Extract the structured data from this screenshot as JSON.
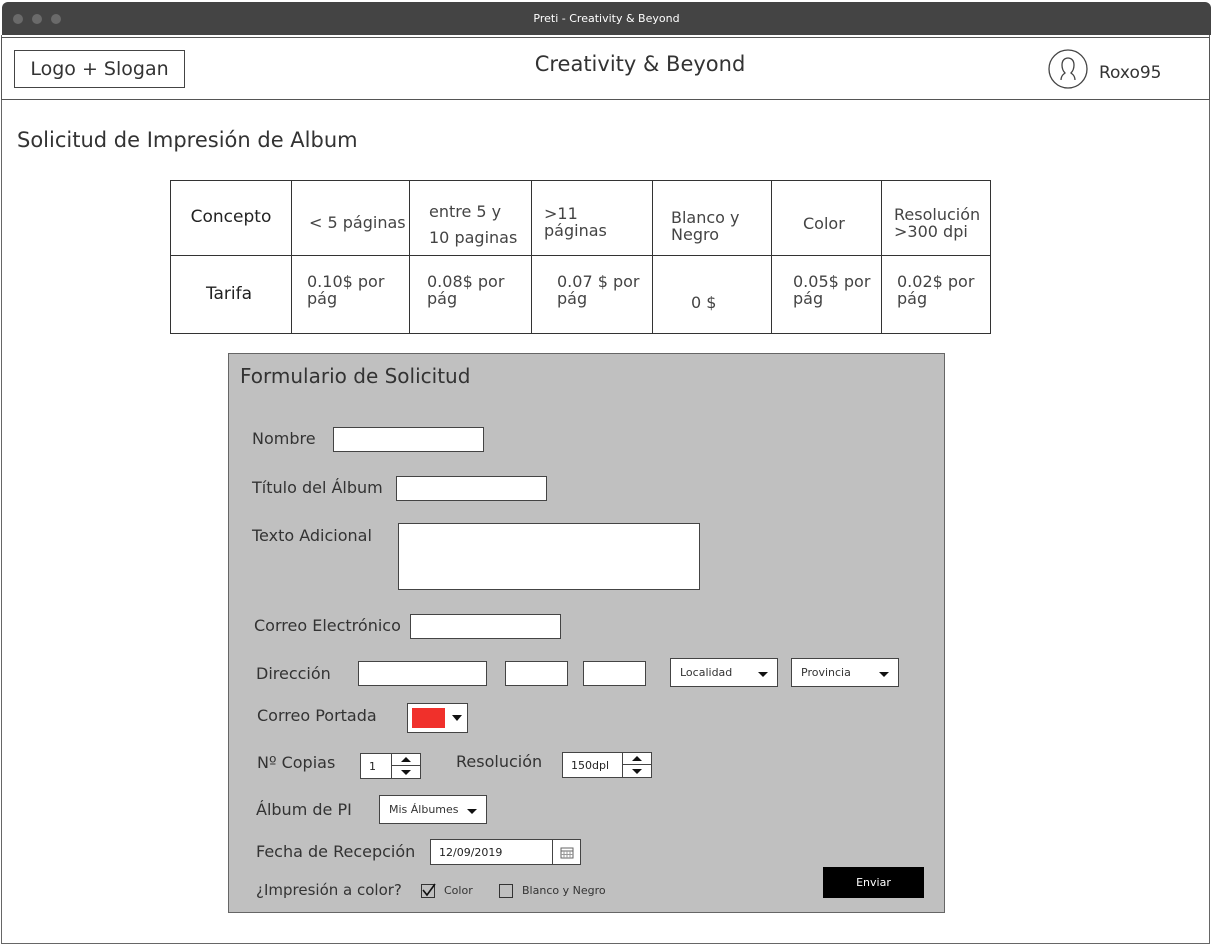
{
  "window": {
    "title": "Preti - Creativity & Beyond"
  },
  "header": {
    "logo_label": "Logo + Slogan",
    "site_title": "Creativity & Beyond",
    "username": "Roxo95"
  },
  "page": {
    "heading": "Solicitud de Impresión de Album"
  },
  "rate_table": {
    "columns": [
      "Concepto",
      "< 5 páginas",
      "entre 5 y 10 paginas",
      ">11 páginas",
      "Blanco y Negro",
      "Color",
      "Resolución >300 dpi"
    ],
    "row": [
      "Tarifa",
      "0.10$ por pág",
      "0.08$ por pág",
      "0.07 $ por pág",
      "0 $",
      "0.05$ por pág",
      "0.02$ por pág"
    ]
  },
  "form": {
    "title": "Formulario de Solicitud",
    "name_label": "Nombre",
    "name_value": "",
    "album_title_label": "Título del Álbum",
    "album_title_value": "",
    "extra_text_label": "Texto Adicional",
    "extra_text_value": "",
    "email_label": "Correo Electrónico",
    "email_value": "",
    "address_label": "Dirección",
    "address_street": "",
    "address_number": "",
    "address_floor": "",
    "locality_select": "Localidad",
    "province_select": "Provincia",
    "cover_label": "Correo Portada",
    "cover_color": "#f0302b",
    "copies_label": "Nº Copias",
    "copies_value": "1",
    "resolution_label": "Resolución",
    "resolution_value": "150dpl",
    "album_pi_label": "Álbum de PI",
    "album_pi_select": "Mis Álbumes",
    "date_label": "Fecha de Recepción",
    "date_value": "12/09/2019",
    "color_print_label": "¿Impresión a color?",
    "option_color": "Color",
    "option_color_checked": true,
    "option_bw": "Blanco y Negro",
    "option_bw_checked": false,
    "submit_label": "Enviar"
  }
}
